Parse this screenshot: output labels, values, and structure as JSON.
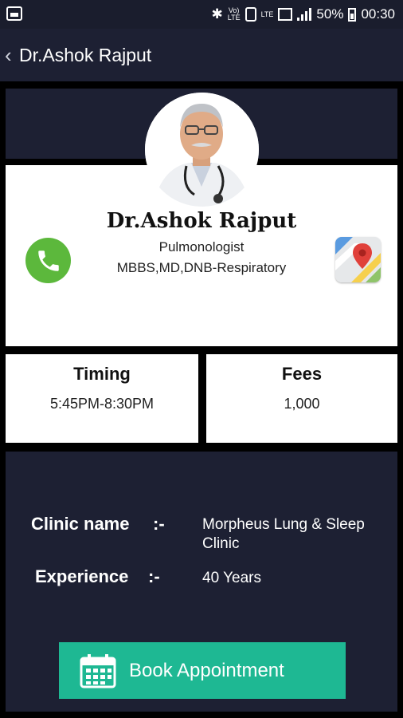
{
  "status_bar": {
    "volte_label": "Vo)\nLTE",
    "lte_label": "LTE",
    "battery_percent": "50%",
    "time": "00:30",
    "battery_level": 0.5
  },
  "app_bar": {
    "back_icon": "chevron-left-icon",
    "title": "Dr.Ashok Rajput"
  },
  "doctor": {
    "name": "Dr.Ashok Rajput",
    "speciality": "Pulmonologist",
    "qualification": "MBBS,MD,DNB-Respiratory",
    "avatar_icon": "doctor-photo",
    "call_icon": "phone-icon",
    "map_icon": "map-pin-icon"
  },
  "timing": {
    "heading": "Timing",
    "value": "5:45PM-8:30PM"
  },
  "fees": {
    "heading": "Fees",
    "value": "1,000"
  },
  "details": {
    "clinic_label": "Clinic name",
    "clinic_sep": ":-",
    "clinic_value_line1": "Morpheus Lung & Sleep",
    "clinic_value_line2": "Clinic",
    "experience_label": "Experience",
    "experience_sep": ":-",
    "experience_value": "40 Years"
  },
  "book_button": {
    "label": "Book Appointment",
    "icon": "calendar-icon"
  },
  "colors": {
    "panel": "#1d2033",
    "accent_green": "#1eb893",
    "call_green": "#5cb83c"
  }
}
